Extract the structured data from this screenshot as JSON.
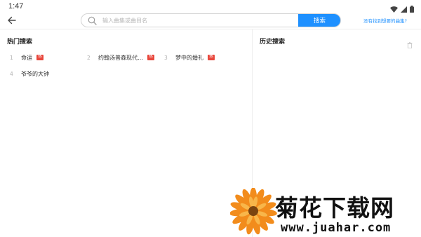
{
  "status_bar": {
    "time": "1:47",
    "icons": [
      "wifi-icon",
      "signal-icon",
      "battery-icon"
    ]
  },
  "header": {
    "back_icon": "back-arrow-icon",
    "search": {
      "placeholder": "输入曲集或曲目名",
      "value": "",
      "icon": "search-icon",
      "button_label": "搜索"
    },
    "request_link": "没有找到想要的曲集?"
  },
  "hot_search": {
    "title": "热门搜索",
    "items": [
      {
        "rank": "1",
        "text": "命运",
        "badge": "热"
      },
      {
        "rank": "2",
        "text": "约翰汤普森现代…",
        "badge": "热"
      },
      {
        "rank": "3",
        "text": "梦中的婚礼",
        "badge": "热"
      },
      {
        "rank": "4",
        "text": "爷爷的大钟",
        "badge": ""
      }
    ]
  },
  "history_search": {
    "title": "历史搜索",
    "clear_icon": "trash-icon",
    "items": []
  },
  "watermark": {
    "title": "菊花下载网",
    "url": "www.juahar.com"
  },
  "colors": {
    "accent": "#1e90ff",
    "hot_badge": "#e8473c",
    "divider": "#eeeeee"
  }
}
